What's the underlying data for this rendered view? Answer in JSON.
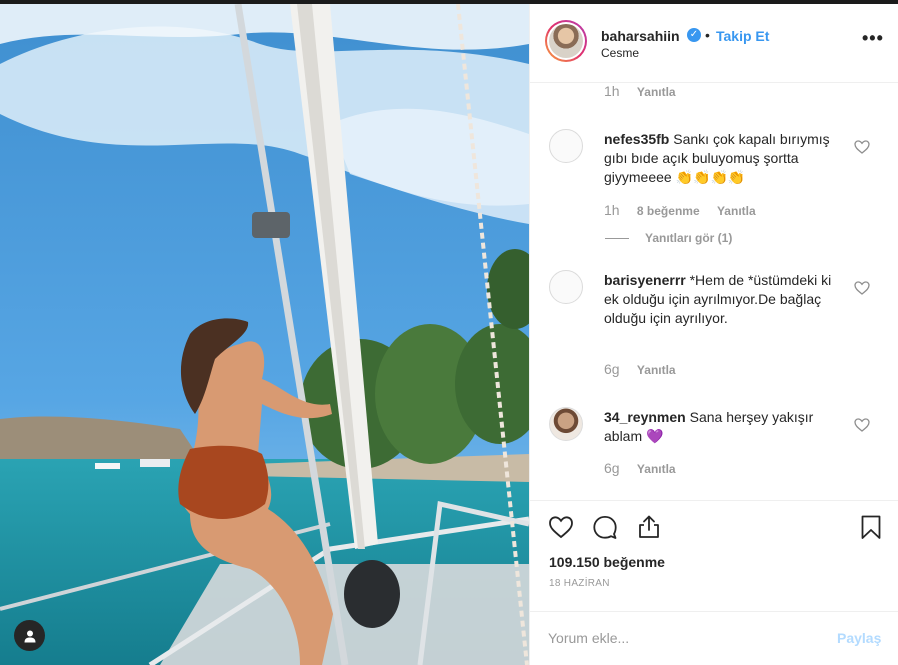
{
  "post": {
    "username": "baharsahiin",
    "verified_icon": "verified-badge-icon",
    "separator": "•",
    "follow_label": "Takip Et",
    "location": "Cesme",
    "more_label": "•••"
  },
  "comments": [
    {
      "time": "1h",
      "reply_label": "Yanıtla"
    },
    {
      "username": "nefes35fb",
      "text": "Sankı çok kapalı bırıymış gıbı bıde açık buluyomuş şortta giyymeeee 👏👏👏👏",
      "time": "1h",
      "likes": "8 beğenme",
      "reply_label": "Yanıtla",
      "view_replies": "Yanıtları gör (1)"
    },
    {
      "username": "barisyenerrr",
      "text": "*Hem de *üstümdeki ki ek olduğu için ayrılmıyor.De bağlaç olduğu için ayrılıyor.",
      "time": "6g",
      "reply_label": "Yanıtla"
    },
    {
      "username": "34_reynmen",
      "text": "Sana herşey yakışır ablam 💜",
      "time": "6g",
      "reply_label": "Yanıtla"
    }
  ],
  "stats": {
    "likes": "109.150 beğenme",
    "date": "18 HAZİRAN"
  },
  "composer": {
    "placeholder": "Yorum ekle...",
    "post_label": "Paylaş"
  },
  "colors": {
    "accent": "#3897f0",
    "muted": "#999999",
    "border": "#efefef",
    "post_disabled": "#b3dbff"
  }
}
